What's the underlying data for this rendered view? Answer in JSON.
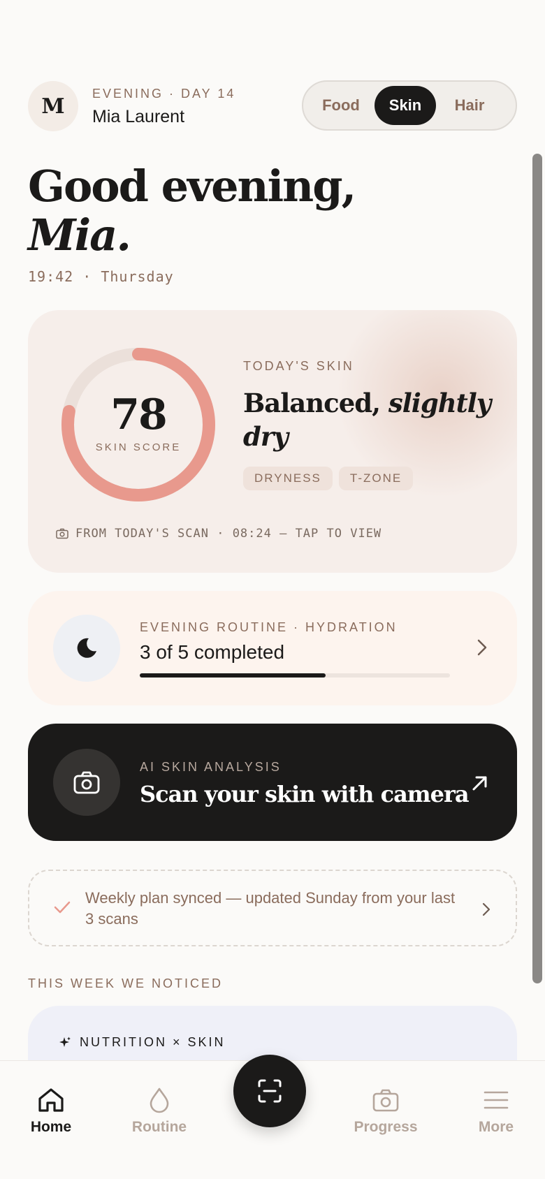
{
  "header": {
    "avatar_initial": "M",
    "eyebrow": "EVENING · DAY 14",
    "user_name": "Mia Laurent",
    "segments": [
      "Food",
      "Skin",
      "Hair"
    ],
    "active_segment": "Skin"
  },
  "greeting": {
    "line1": "Good evening,",
    "name": "Mia.",
    "time_day": "19:42 · Thursday"
  },
  "skin_card": {
    "score": "78",
    "score_fraction": 0.78,
    "score_label": "SKIN SCORE",
    "eyebrow": "TODAY'S SKIN",
    "title_plain": "Balanced,",
    "title_italic": "slightly dry",
    "tags": [
      "DRYNESS",
      "T-ZONE"
    ],
    "scan_info": "FROM TODAY'S SCAN · 08:24 — TAP TO VIEW",
    "ring_color": "#e8998d"
  },
  "routine": {
    "eyebrow": "EVENING ROUTINE · HYDRATION",
    "status": "3 of 5 completed",
    "completed": 3,
    "total": 5,
    "icon": "moon-icon"
  },
  "ai": {
    "eyebrow": "AI SKIN ANALYSIS",
    "title": "Scan your skin with camera",
    "icon": "camera-icon"
  },
  "sync": {
    "text": "Weekly plan synced — updated Sunday from your last 3 scans"
  },
  "noticed": {
    "eyebrow": "THIS WEEK WE NOTICED",
    "card_label": "NUTRITION × SKIN"
  },
  "nav": {
    "items": [
      {
        "label": "Home",
        "icon": "home-icon",
        "active": true
      },
      {
        "label": "Routine",
        "icon": "drop-icon",
        "active": false
      },
      {
        "label": "Progress",
        "icon": "camera-icon",
        "active": false
      },
      {
        "label": "More",
        "icon": "menu-icon",
        "active": false
      }
    ],
    "fab_icon": "scan-icon"
  },
  "colors": {
    "accent": "#e8998d",
    "dark": "#1b1a19",
    "muted_brown": "#8a6c5c"
  }
}
